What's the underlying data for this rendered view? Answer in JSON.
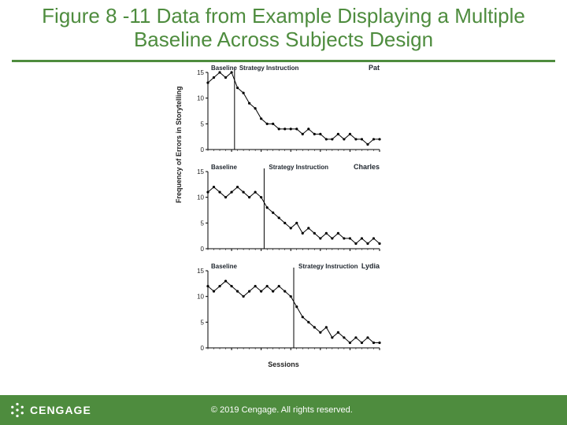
{
  "title": "Figure 8 -11 Data from Example Displaying a Multiple Baseline Across Subjects Design",
  "axis": {
    "ylabel": "Frequency of Errors in Storytelling",
    "xlabel": "Sessions"
  },
  "logo_text": "CENGAGE",
  "copyright": "© 2019 Cengage. All rights reserved.",
  "chart_data": [
    {
      "type": "line",
      "subject": "Pat",
      "ylim": [
        0,
        15
      ],
      "baseline_end_x": 5,
      "conditions": {
        "baseline": "Baseline",
        "treatment": "Strategy Instruction"
      },
      "x": [
        1,
        2,
        3,
        4,
        5,
        6,
        7,
        8,
        9,
        10,
        11,
        12,
        13,
        14,
        15,
        16,
        17,
        18,
        19,
        20,
        21,
        22,
        23,
        24,
        25,
        26,
        27,
        28,
        29,
        30
      ],
      "y": [
        13,
        14,
        15,
        14,
        15,
        12,
        11,
        9,
        8,
        6,
        5,
        5,
        4,
        4,
        4,
        4,
        3,
        4,
        3,
        3,
        2,
        2,
        3,
        2,
        3,
        2,
        2,
        1,
        2,
        2
      ]
    },
    {
      "type": "line",
      "subject": "Charles",
      "ylim": [
        0,
        15
      ],
      "baseline_end_x": 10,
      "conditions": {
        "baseline": "Baseline",
        "treatment": "Strategy Instruction"
      },
      "x": [
        1,
        2,
        3,
        4,
        5,
        6,
        7,
        8,
        9,
        10,
        11,
        12,
        13,
        14,
        15,
        16,
        17,
        18,
        19,
        20,
        21,
        22,
        23,
        24,
        25,
        26,
        27,
        28,
        29,
        30
      ],
      "y": [
        11,
        12,
        11,
        10,
        11,
        12,
        11,
        10,
        11,
        10,
        8,
        7,
        6,
        5,
        4,
        5,
        3,
        4,
        3,
        2,
        3,
        2,
        3,
        2,
        2,
        1,
        2,
        1,
        2,
        1
      ]
    },
    {
      "type": "line",
      "subject": "Lydia",
      "ylim": [
        0,
        15
      ],
      "baseline_end_x": 15,
      "conditions": {
        "baseline": "Baseline",
        "treatment": "Strategy Instruction"
      },
      "x": [
        1,
        2,
        3,
        4,
        5,
        6,
        7,
        8,
        9,
        10,
        11,
        12,
        13,
        14,
        15,
        16,
        17,
        18,
        19,
        20,
        21,
        22,
        23,
        24,
        25,
        26,
        27,
        28,
        29,
        30
      ],
      "y": [
        12,
        11,
        12,
        13,
        12,
        11,
        10,
        11,
        12,
        11,
        12,
        11,
        12,
        11,
        10,
        8,
        6,
        5,
        4,
        3,
        4,
        2,
        3,
        2,
        1,
        2,
        1,
        2,
        1,
        1
      ]
    }
  ]
}
